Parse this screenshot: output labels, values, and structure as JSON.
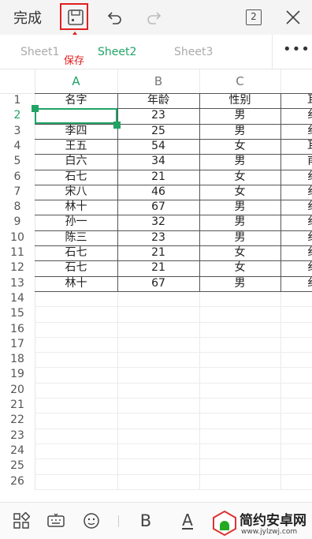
{
  "toolbar": {
    "done_label": "完成",
    "sheet_count": "2",
    "save_annotation": "保存"
  },
  "tabs": [
    {
      "label": "Sheet1",
      "active": false
    },
    {
      "label": "Sheet2",
      "active": true
    },
    {
      "label": "Sheet3",
      "active": false
    }
  ],
  "more_label": "•••",
  "columns": [
    "A",
    "B",
    "C"
  ],
  "selected_column": "A",
  "selected_row": 2,
  "rows": [
    {
      "num": "1",
      "cells": [
        "名字",
        "年龄",
        "性别",
        "耳"
      ]
    },
    {
      "num": "2",
      "cells": [
        "",
        "23",
        "男",
        "纟"
      ]
    },
    {
      "num": "3",
      "cells": [
        "李四",
        "25",
        "男",
        "纟"
      ]
    },
    {
      "num": "4",
      "cells": [
        "王五",
        "54",
        "女",
        "耳"
      ]
    },
    {
      "num": "5",
      "cells": [
        "白六",
        "34",
        "男",
        "甫"
      ]
    },
    {
      "num": "6",
      "cells": [
        "石七",
        "21",
        "女",
        "纟"
      ]
    },
    {
      "num": "7",
      "cells": [
        "宋八",
        "46",
        "女",
        "纟"
      ]
    },
    {
      "num": "8",
      "cells": [
        "林十",
        "67",
        "男",
        "纟"
      ]
    },
    {
      "num": "9",
      "cells": [
        "孙一",
        "32",
        "男",
        "纟"
      ]
    },
    {
      "num": "10",
      "cells": [
        "陈三",
        "23",
        "男",
        "纟"
      ]
    },
    {
      "num": "11",
      "cells": [
        "石七",
        "21",
        "女",
        "纟"
      ]
    },
    {
      "num": "12",
      "cells": [
        "石七",
        "21",
        "女",
        "纟"
      ]
    },
    {
      "num": "13",
      "cells": [
        "林十",
        "67",
        "男",
        "纟"
      ]
    },
    {
      "num": "14",
      "cells": [
        "",
        "",
        "",
        ""
      ]
    },
    {
      "num": "15",
      "cells": [
        "",
        "",
        "",
        ""
      ]
    },
    {
      "num": "16",
      "cells": [
        "",
        "",
        "",
        ""
      ]
    },
    {
      "num": "17",
      "cells": [
        "",
        "",
        "",
        ""
      ]
    },
    {
      "num": "18",
      "cells": [
        "",
        "",
        "",
        ""
      ]
    },
    {
      "num": "19",
      "cells": [
        "",
        "",
        "",
        ""
      ]
    },
    {
      "num": "20",
      "cells": [
        "",
        "",
        "",
        ""
      ]
    },
    {
      "num": "21",
      "cells": [
        "",
        "",
        "",
        ""
      ]
    },
    {
      "num": "22",
      "cells": [
        "",
        "",
        "",
        ""
      ]
    },
    {
      "num": "23",
      "cells": [
        "",
        "",
        "",
        ""
      ]
    },
    {
      "num": "24",
      "cells": [
        "",
        "",
        "",
        ""
      ]
    },
    {
      "num": "25",
      "cells": [
        "",
        "",
        "",
        ""
      ]
    },
    {
      "num": "26",
      "cells": [
        "",
        "",
        "",
        ""
      ]
    }
  ],
  "bottom": {
    "bold_label": "B",
    "underline_label": "A"
  },
  "watermark": {
    "title": "简约安卓网",
    "url": "www.jylzwj.com"
  },
  "colors": {
    "accent": "#21a366",
    "annotation": "#e02020"
  }
}
